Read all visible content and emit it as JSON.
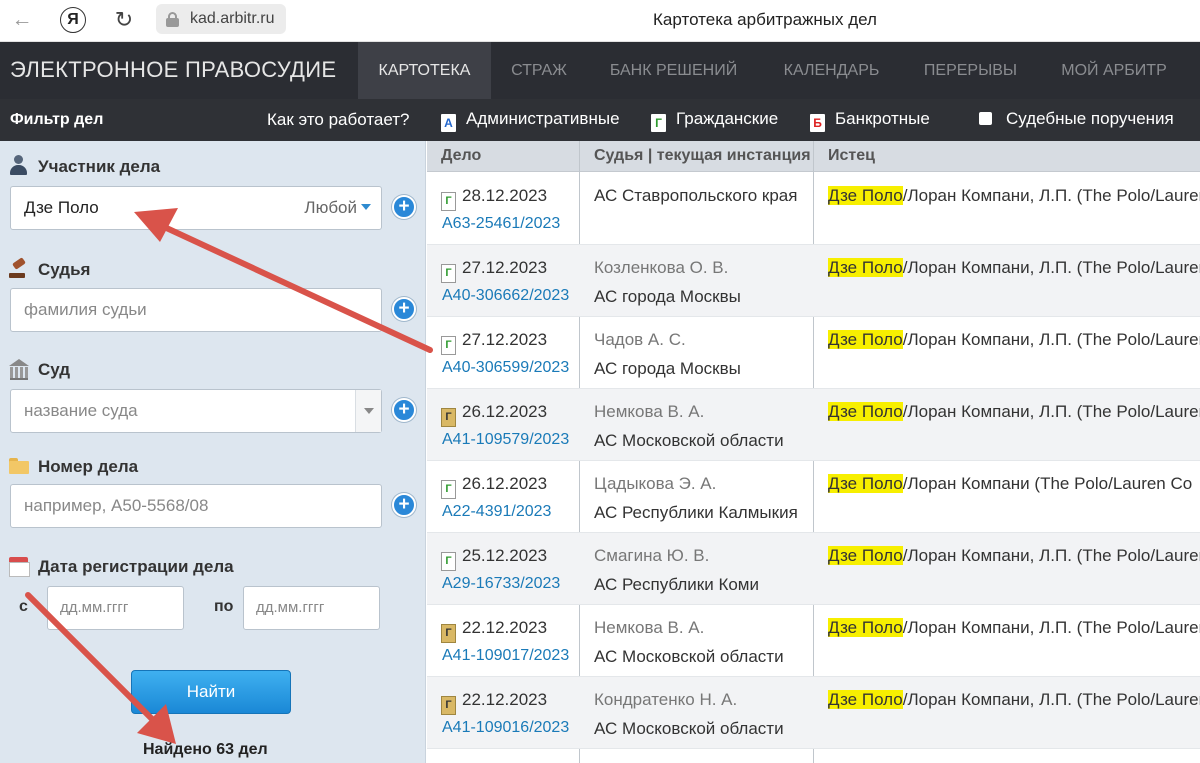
{
  "browser": {
    "url": "kad.arbitr.ru",
    "title": "Картотека арбитражных дел",
    "yandex_glyph": "Я"
  },
  "nav": {
    "logo": "ЭЛЕКТРОННОЕ ПРАВОСУДИЕ",
    "tabs": [
      {
        "label": "КАРТОТЕКА",
        "active": true
      },
      {
        "label": "СТРАЖ"
      },
      {
        "label": "БАНК РЕШЕНИЙ"
      },
      {
        "label": "КАЛЕНДАРЬ"
      },
      {
        "label": "ПЕРЕРЫВЫ"
      },
      {
        "label": "МОЙ АРБИТР"
      }
    ]
  },
  "subheader": {
    "filter_title": "Фильтр дел",
    "how_link": "Как это работает?",
    "categories": [
      {
        "label": "Административные",
        "icon_letter": "А"
      },
      {
        "label": "Гражданские",
        "icon_letter": "Г"
      },
      {
        "label": "Банкротные",
        "icon_letter": "Б"
      },
      {
        "label": "Судебные поручения"
      }
    ]
  },
  "filter": {
    "participant": {
      "label": "Участник дела",
      "value": "Дзе Поло",
      "dropdown": "Любой"
    },
    "judge": {
      "label": "Судья",
      "placeholder": "фамилия судьи"
    },
    "court": {
      "label": "Суд",
      "placeholder": "название суда"
    },
    "case_number": {
      "label": "Номер дела",
      "placeholder": "например, А50-5568/08"
    },
    "reg_date": {
      "label": "Дата регистрации дела",
      "from_prefix": "с",
      "to_prefix": "по",
      "from_placeholder": "дд.мм.гггг",
      "to_placeholder": "дд.мм.гггг"
    },
    "find_button": "Найти",
    "found": "Найдено 63 дел",
    "plus_glyph": "+"
  },
  "table": {
    "headers": {
      "case": "Дело",
      "judge": "Судья | текущая инстанция",
      "plaintiff": "Истец"
    },
    "highlight": "Дзе Поло",
    "rows": [
      {
        "icon": "Г",
        "archived": false,
        "date": "28.12.2023",
        "number": "А63-25461/2023",
        "judge": "АС Ставропольского края",
        "court": "",
        "plaintiff_rest": "/Лоран Компани, Л.П. (The Polo/Lauren"
      },
      {
        "icon": "Г",
        "archived": false,
        "date": "27.12.2023",
        "number": "А40-306662/2023",
        "judge": "Козленкова О. В.",
        "court": "АС города Москвы",
        "plaintiff_rest": "/Лоран Компани, Л.П. (The Polo/Lauren"
      },
      {
        "icon": "Г",
        "archived": false,
        "date": "27.12.2023",
        "number": "А40-306599/2023",
        "judge": "Чадов А. С.",
        "court": "АС города Москвы",
        "plaintiff_rest": "/Лоран Компани, Л.П. (The Polo/Lauren"
      },
      {
        "icon": "Г",
        "archived": true,
        "date": "26.12.2023",
        "number": "А41-109579/2023",
        "judge": "Немкова В. А.",
        "court": "АС Московской области",
        "plaintiff_rest": "/Лоран Компани, Л.П. (The Polo/Lauren"
      },
      {
        "icon": "Г",
        "archived": false,
        "date": "26.12.2023",
        "number": "А22-4391/2023",
        "judge": "Цадыкова Э. А.",
        "court": "АС Республики Калмыкия",
        "plaintiff_rest": "/Лоран Компани (The Polo/Lauren Co"
      },
      {
        "icon": "Г",
        "archived": false,
        "date": "25.12.2023",
        "number": "А29-16733/2023",
        "judge": "Смагина Ю. В.",
        "court": "АС Республики Коми",
        "plaintiff_rest": "/Лоран Компани, Л.П. (The Polo/Lauren"
      },
      {
        "icon": "Г",
        "archived": true,
        "date": "22.12.2023",
        "number": "А41-109017/2023",
        "judge": "Немкова В. А.",
        "court": "АС Московской области",
        "plaintiff_rest": "/Лоран Компани, Л.П. (The Polo/Lauren"
      },
      {
        "icon": "Г",
        "archived": true,
        "date": "22.12.2023",
        "number": "А41-109016/2023",
        "judge": "Кондратенко Н. А.",
        "court": "АС Московской области",
        "plaintiff_rest": "/Лоран Компани, Л.П. (The Polo/Lauren"
      }
    ]
  },
  "colors": {
    "nav_bg": "#2b2d33",
    "panel_bg": "#dde6ef",
    "link": "#1a7ab8",
    "highlight": "#f7ef00",
    "arrow": "#d9534a"
  }
}
